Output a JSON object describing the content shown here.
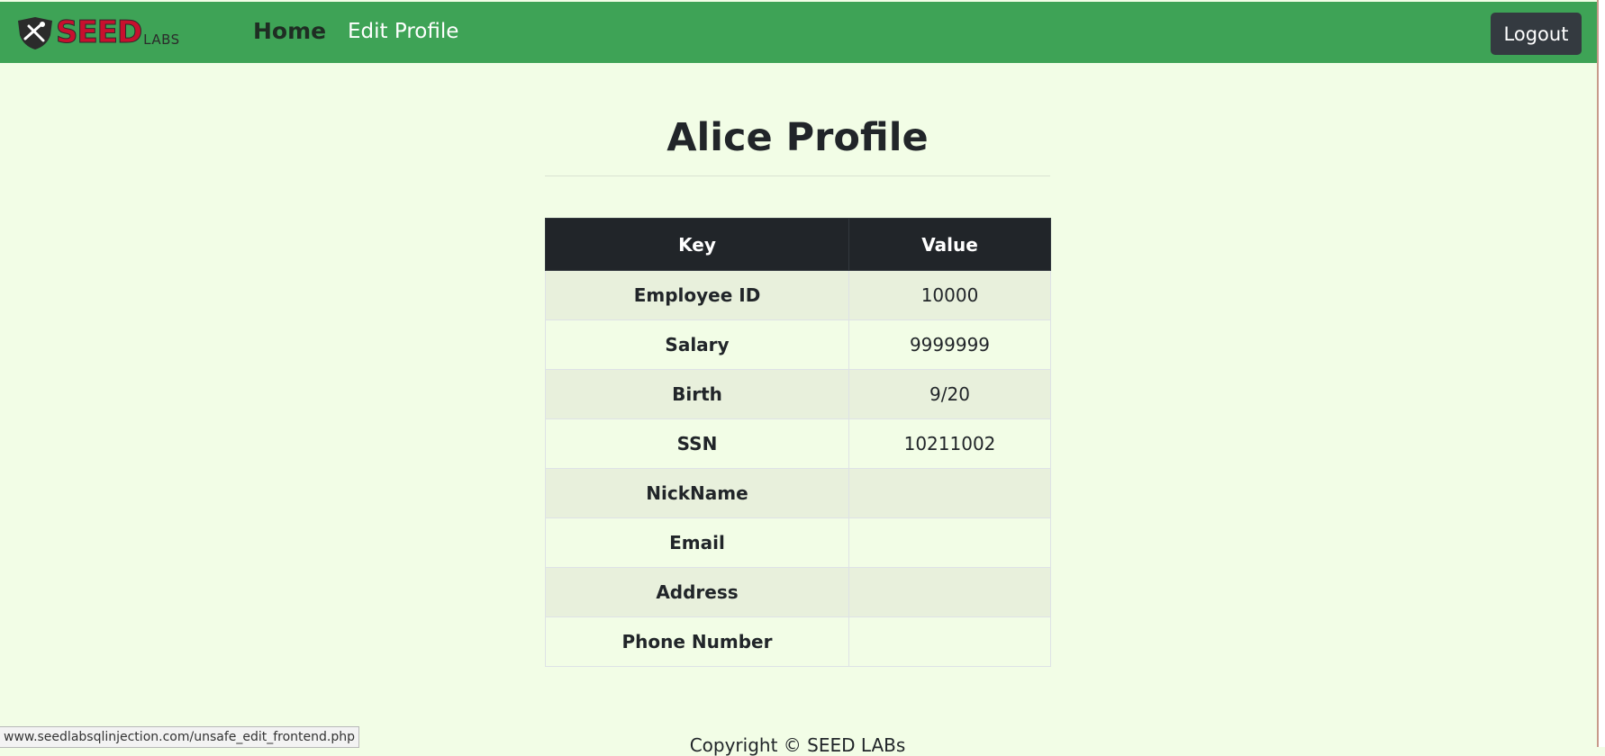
{
  "navbar": {
    "logo_seed": "SEED",
    "logo_labs": "LABS",
    "home_label": "Home",
    "edit_profile_label": "Edit Profile",
    "logout_label": "Logout",
    "background_color": "#3ea356"
  },
  "main": {
    "title": "Alice Profile",
    "table": {
      "headers": [
        "Key",
        "Value"
      ],
      "rows": [
        {
          "key": "Employee ID",
          "value": "10000"
        },
        {
          "key": "Salary",
          "value": "9999999"
        },
        {
          "key": "Birth",
          "value": "9/20"
        },
        {
          "key": "SSN",
          "value": "10211002"
        },
        {
          "key": "NickName",
          "value": ""
        },
        {
          "key": "Email",
          "value": ""
        },
        {
          "key": "Address",
          "value": ""
        },
        {
          "key": "Phone Number",
          "value": ""
        }
      ]
    }
  },
  "footer": {
    "copyright": "Copyright © SEED LABs"
  },
  "status_bar": {
    "url": "www.seedlabsqlinjection.com/unsafe_edit_frontend.php"
  }
}
